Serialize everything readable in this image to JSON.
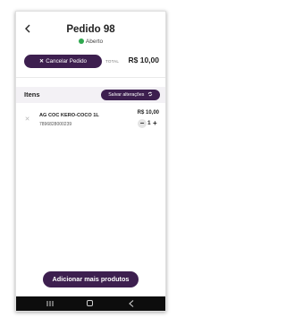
{
  "header": {
    "title": "Pedido 98",
    "status": "Aberto",
    "back_icon": "chevron-left-icon"
  },
  "summary": {
    "cancel_label": "Cancelar Pedido",
    "total_label": "TOTAL",
    "total_value": "R$ 10,00"
  },
  "items_section": {
    "title": "Itens",
    "save_label": "Salvar alterações"
  },
  "items": [
    {
      "name": "AG COC KERO-COCO 1L",
      "code": "7896828000239",
      "price": "R$ 10,00",
      "quantity": "1"
    }
  ],
  "footer": {
    "add_label": "Adicionar mais produtos"
  },
  "colors": {
    "brand": "#3d1f4f",
    "status_open": "#2fa84f"
  }
}
